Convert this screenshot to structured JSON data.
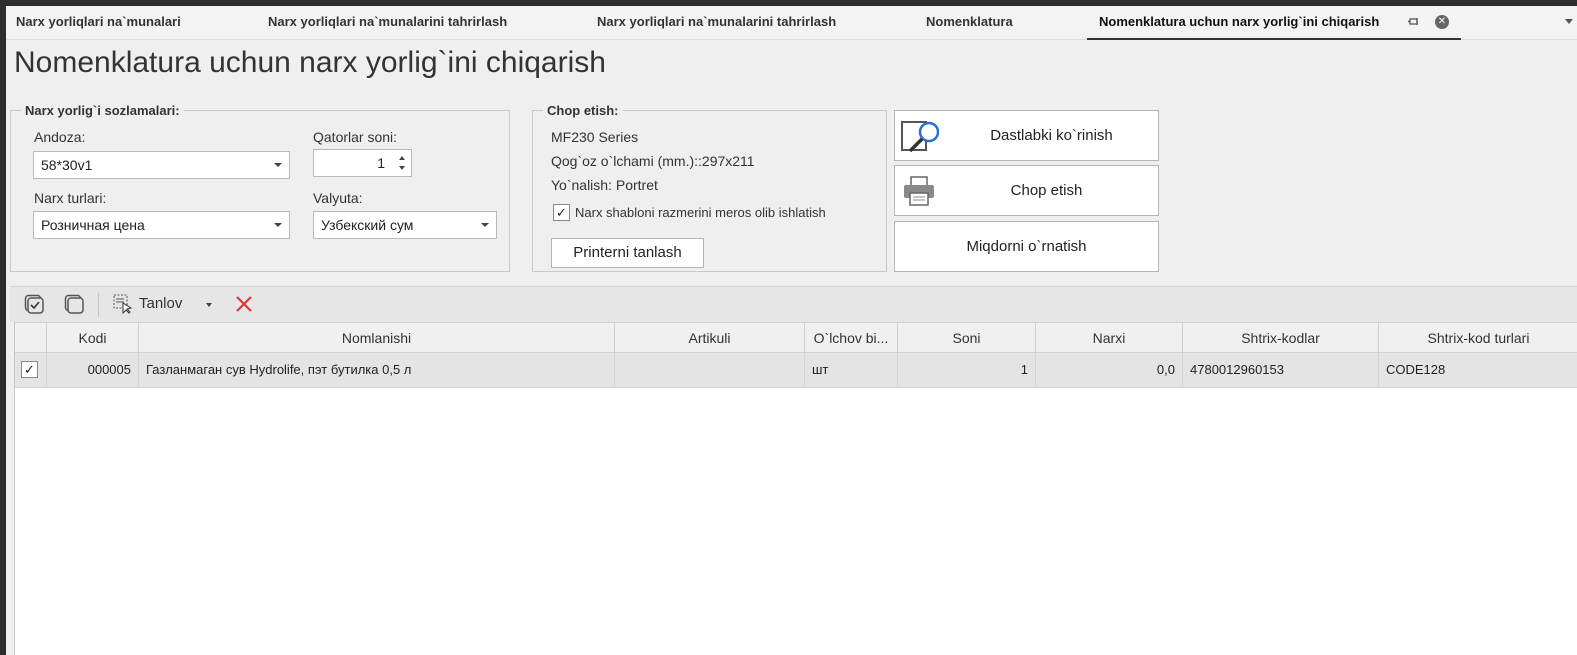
{
  "tabs": [
    {
      "label": "Narx yorliqlari na`munalari",
      "active": false
    },
    {
      "label": "Narx yorliqlari na`munalarini tahrirlash",
      "active": false
    },
    {
      "label": "Narx yorliqlari na`munalarini tahrirlash",
      "active": false
    },
    {
      "label": "Nomenklatura",
      "active": false
    },
    {
      "label": "Nomenklatura uchun narx yorlig`ini chiqarish",
      "active": true
    }
  ],
  "tab_icons": {
    "pin": "pin-icon",
    "close": "close-icon",
    "menu": "chevron-down-icon"
  },
  "page_title": "Nomenklatura uchun narx yorlig`ini chiqarish",
  "settings": {
    "legend": "Narx yorlig`i sozlamalari:",
    "template_label": "Andoza:",
    "template_value": "58*30v1",
    "rows_label": "Qatorlar soni:",
    "rows_value": "1",
    "price_types_label": "Narx turlari:",
    "price_types_value": "Розничная цена",
    "currency_label": "Valyuta:",
    "currency_value": "Узбекский сум"
  },
  "print": {
    "legend": "Chop etish:",
    "printer_name": "MF230 Series",
    "paper_size": "Qog`oz o`lchami (mm.)::297x211",
    "orientation": "Yo`nalish: Portret",
    "inherit_checkbox_label": "Narx shabloni razmerini meros olib ishlatish",
    "inherit_checked": true,
    "select_printer_button": "Printerni tanlash"
  },
  "actions": {
    "preview_button": "Dastlabki ko`rinish",
    "print_button": "Chop etish",
    "set_quantity_button": "Miqdorni o`rnatish"
  },
  "toolbar": {
    "select_label": "Tanlov",
    "icons": [
      "check-all-icon",
      "uncheck-all-icon",
      "select-icon",
      "delete-icon"
    ]
  },
  "grid": {
    "columns": [
      "",
      "Kodi",
      "Nomlanishi",
      "Artikuli",
      "O`lchov bi...",
      "Soni",
      "Narxi",
      "Shtrix-kodlar",
      "Shtrix-kod turlari"
    ],
    "rows": [
      {
        "checked": true,
        "code": "000005",
        "name": "Газланмаган сув Hydrolife, пэт бутилка 0,5 л",
        "article": "",
        "unit": "шт",
        "quantity": "1",
        "price": "0,0",
        "barcode": "4780012960153",
        "barcode_type": "CODE128"
      }
    ]
  },
  "colors": {
    "accent_delete": "#e0312f",
    "preview_icon": "#2a6fd6"
  }
}
